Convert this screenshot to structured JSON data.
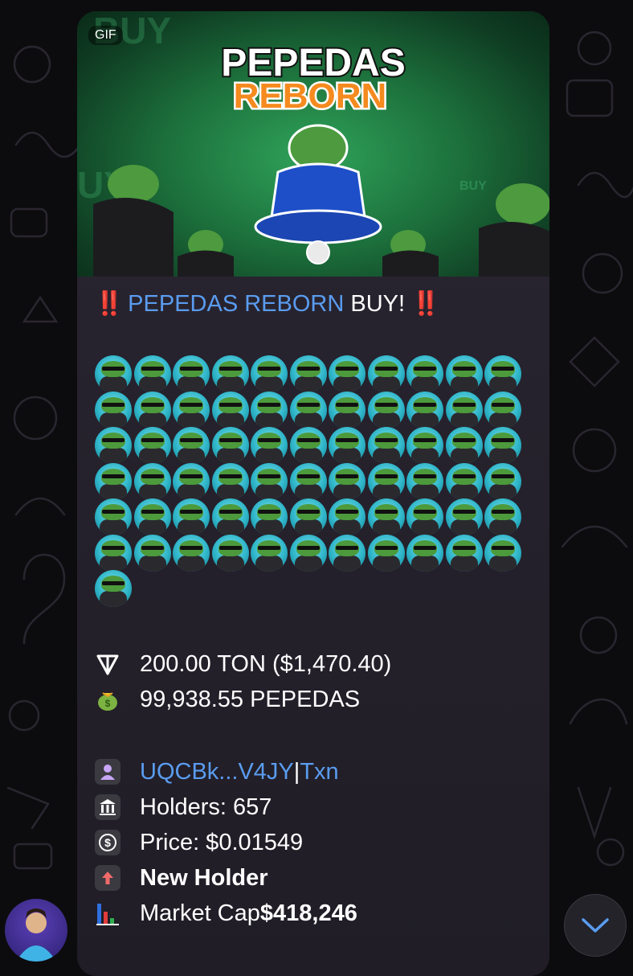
{
  "media": {
    "badge": "GIF",
    "title_line1": "PEPEDAS",
    "title_line2": "REBORN",
    "bg_word": "BUY"
  },
  "message": {
    "headline_excl": "‼️",
    "headline_link": "PEPEDAS REBORN",
    "headline_rest": " BUY! ",
    "emoji_count": 67,
    "ton_amount": "200.00 TON ($1,470.40)",
    "token_amount": "99,938.55 PEPEDAS",
    "buyer_link": "UQCBk...V4JY",
    "separator": " | ",
    "txn_link": "Txn",
    "holders": "Holders: 657",
    "price": "Price: $0.01549",
    "new_holder": "New Holder",
    "market_cap_label": "Market Cap ",
    "market_cap_value": "$418,246"
  },
  "icons": {
    "ton": "ton-icon",
    "money_bag": "money-bag-icon",
    "user": "user-icon",
    "bank": "bank-icon",
    "dollar": "dollar-icon",
    "up_arrow": "up-arrow-icon",
    "chart": "bar-chart-icon",
    "scroll": "chevron-down-icon"
  },
  "colors": {
    "link": "#5a9cf0",
    "exclaim": "#e8352c",
    "title_orange": "#f58a1f"
  }
}
